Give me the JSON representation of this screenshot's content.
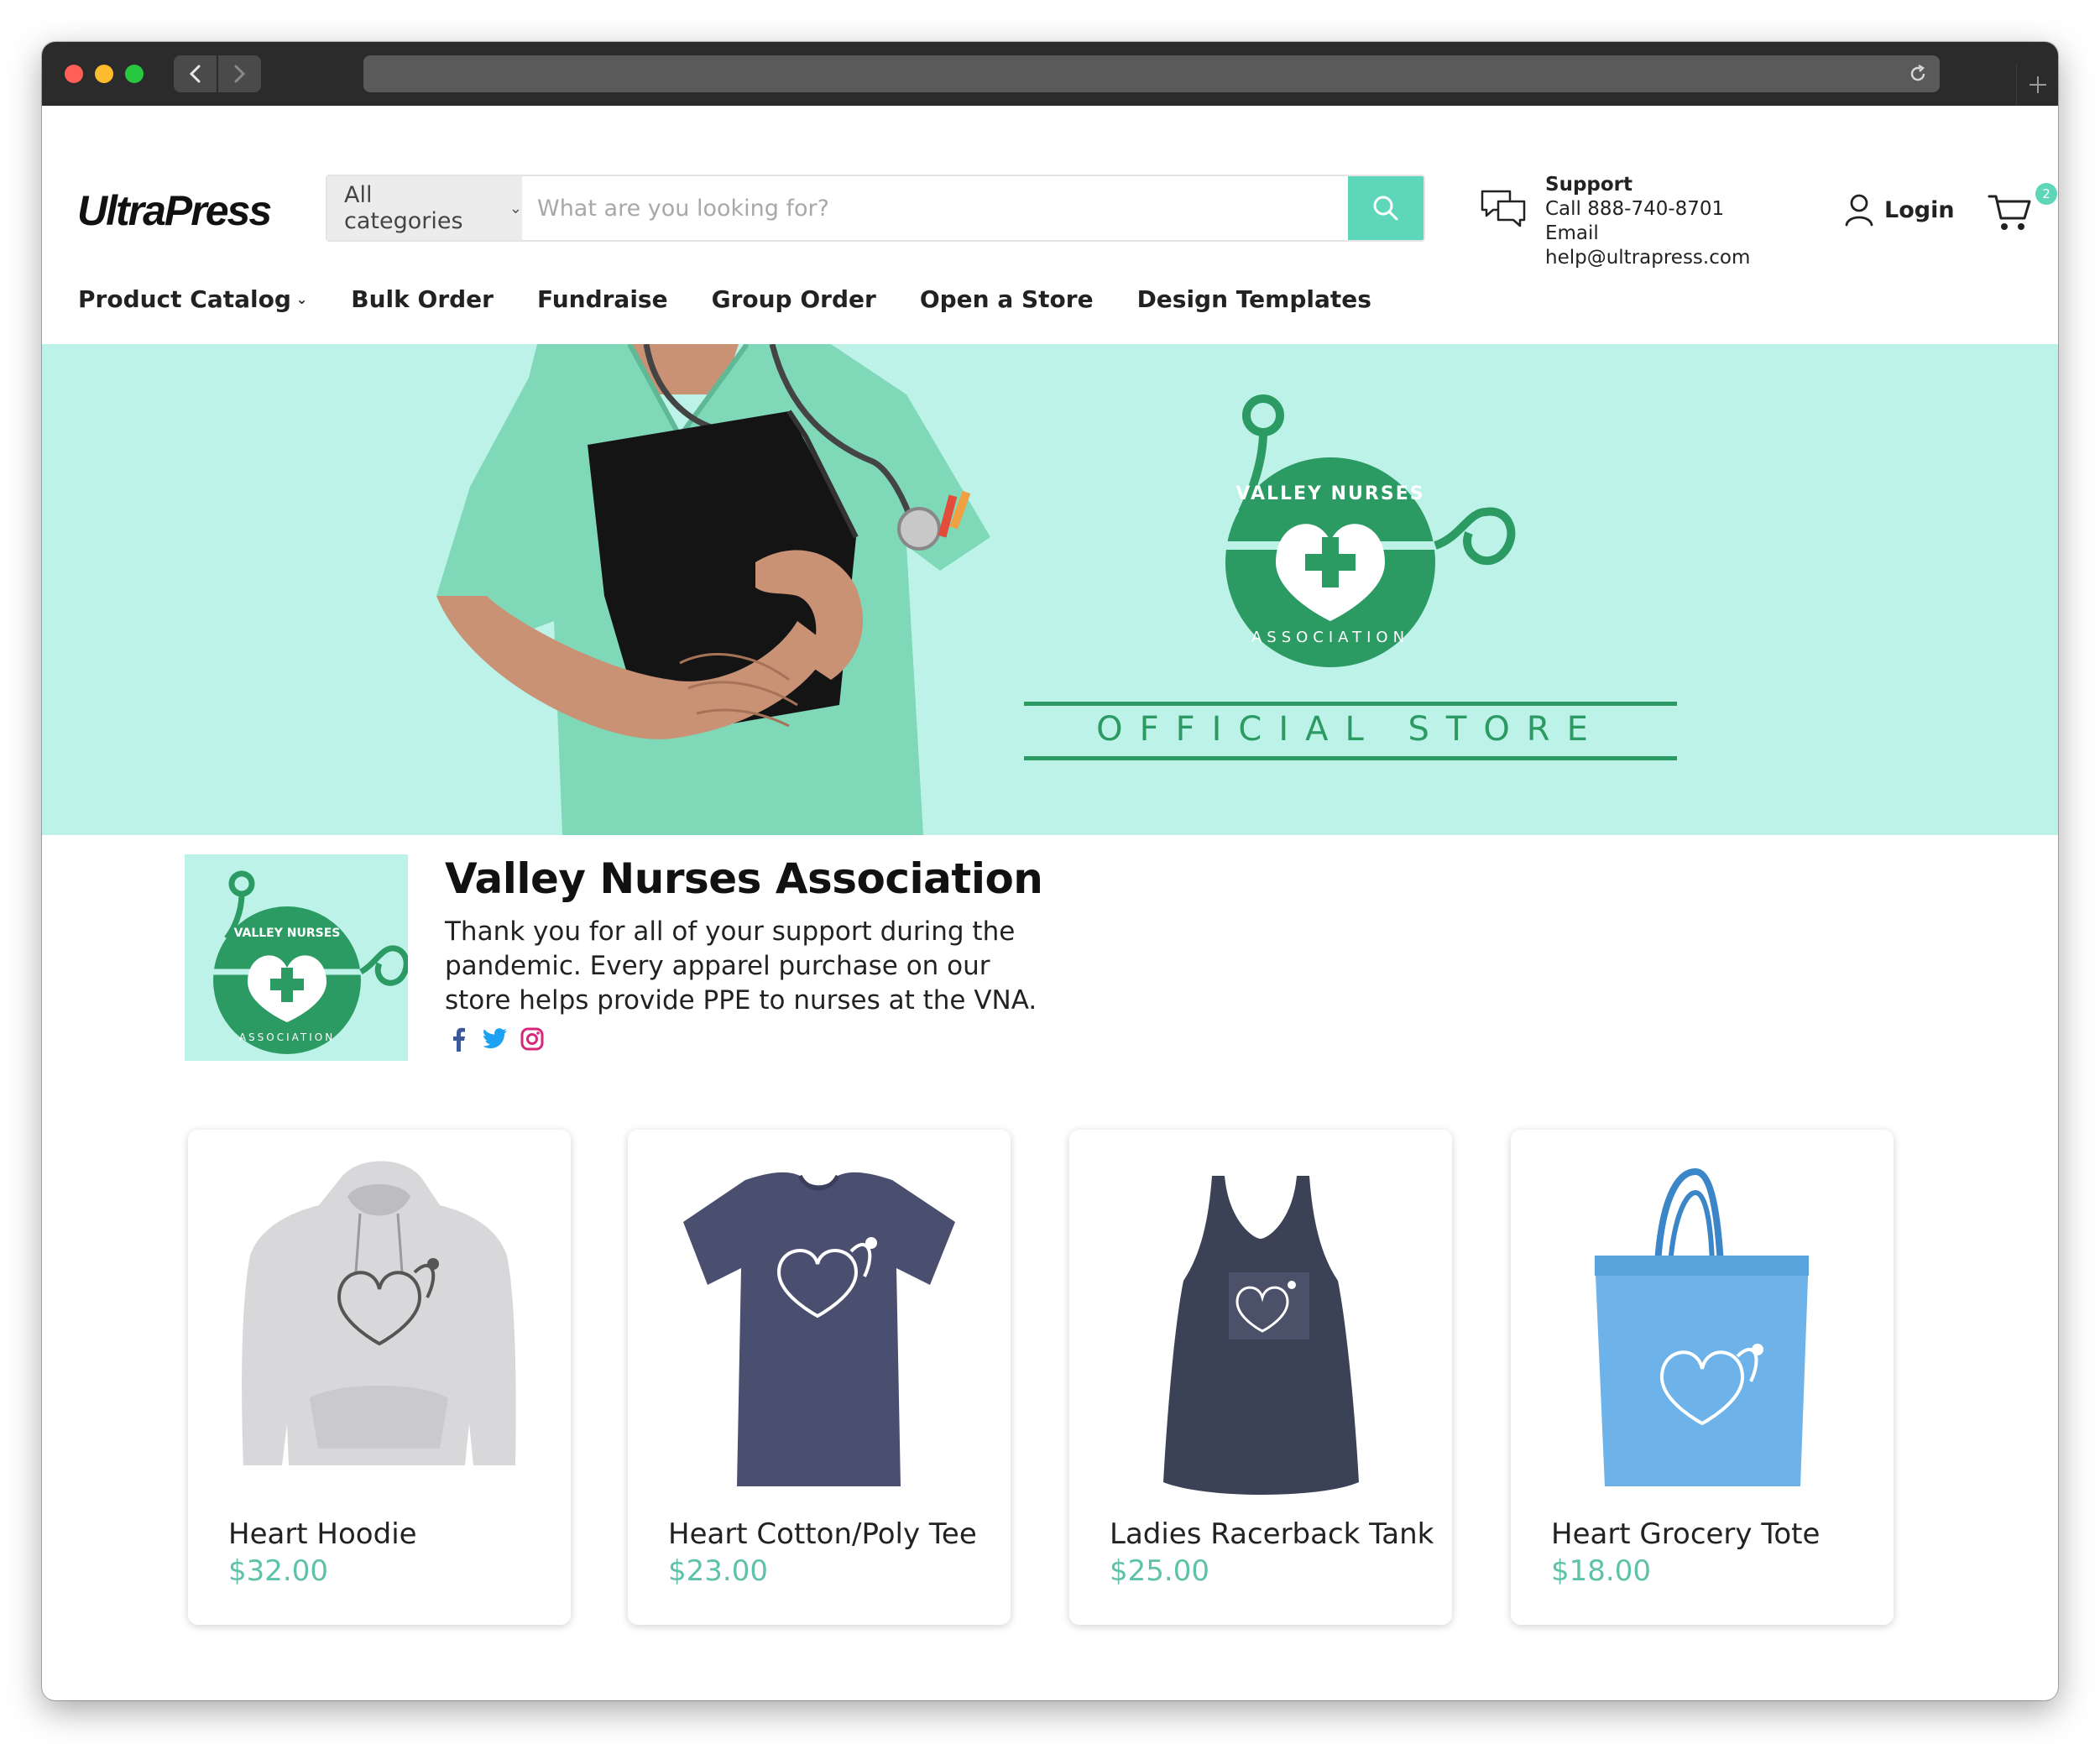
{
  "browser": {
    "back_icon": "chevron-left-icon",
    "forward_icon": "chevron-right-icon",
    "reload_icon": "reload-icon",
    "new_tab_icon": "plus-icon"
  },
  "header": {
    "logo": "UltraPress",
    "search": {
      "category": "All categories",
      "placeholder": "What are you looking for?",
      "button_icon": "search-icon"
    },
    "support": {
      "title": "Support",
      "phone": "Call 888-740-8701",
      "email": "Email help@ultrapress.com"
    },
    "login_label": "Login",
    "cart_count": "2"
  },
  "nav": {
    "items": [
      "Product Catalog",
      "Bulk Order",
      "Fundraise",
      "Group Order",
      "Open a Store",
      "Design Templates"
    ]
  },
  "hero": {
    "logo_top_text": "VALLEY NURSES",
    "logo_bottom_text": "ASSOCIATION",
    "store_text": "OFFICIAL STORE"
  },
  "org": {
    "name": "Valley Nurses Association",
    "description": "Thank you for all of your support during the pandemic. Every apparel purchase on our store helps provide PPE to nurses at the VNA.",
    "social_icons": [
      "facebook-icon",
      "twitter-icon",
      "instagram-icon"
    ]
  },
  "products": [
    {
      "name": "Heart Hoodie",
      "price": "$32.00"
    },
    {
      "name": "Heart Cotton/Poly Tee",
      "price": "$23.00"
    },
    {
      "name": "Ladies Racerback Tank",
      "price": "$25.00"
    },
    {
      "name": "Heart Grocery Tote",
      "price": "$18.00"
    }
  ],
  "colors": {
    "accent": "#5ed6b9",
    "price": "#5ec2a8",
    "hero_bg": "#bdf2e9",
    "logo_green": "#2c9a63"
  }
}
